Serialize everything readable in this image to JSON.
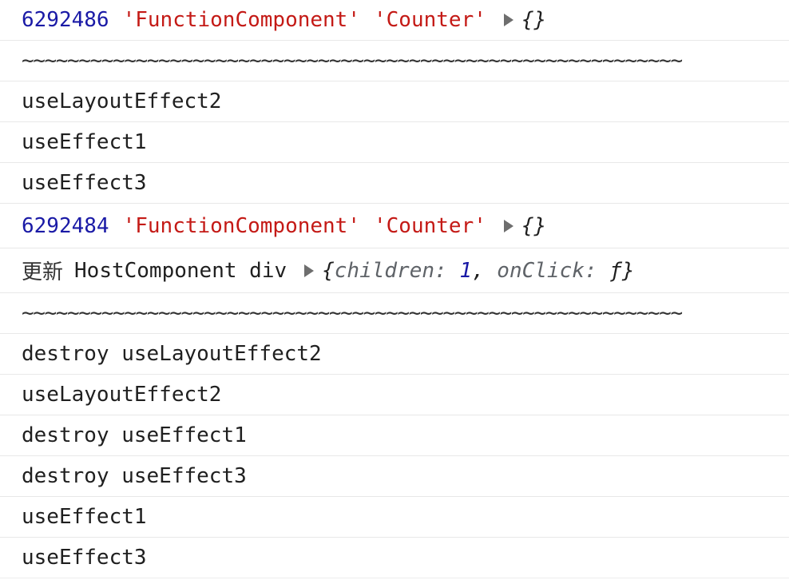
{
  "rows": [
    {
      "type": "component-log",
      "id": "6292486",
      "tag": "'FunctionComponent'",
      "name": "'Counter'",
      "object": "{}"
    },
    {
      "type": "separator",
      "text": "~~~~~~~~~~~~~~~~~~~~~~~~~~~~~~~~~~~~~~~~~~~~~~~~~~~~~~~~~~"
    },
    {
      "type": "text",
      "text": "useLayoutEffect2"
    },
    {
      "type": "text",
      "text": "useEffect1"
    },
    {
      "type": "text",
      "text": "useEffect3"
    },
    {
      "type": "component-log",
      "id": "6292484",
      "tag": "'FunctionComponent'",
      "name": "'Counter'",
      "object": "{}"
    },
    {
      "type": "update-log",
      "prefix": "更新",
      "text": "HostComponent div",
      "object_open": "{",
      "key1": "children",
      "colon": ": ",
      "value1": "1",
      "comma": ", ",
      "key2": "onClick",
      "value2": "ƒ",
      "object_close": "}"
    },
    {
      "type": "separator",
      "text": "~~~~~~~~~~~~~~~~~~~~~~~~~~~~~~~~~~~~~~~~~~~~~~~~~~~~~~~~~~"
    },
    {
      "type": "text",
      "text": "destroy useLayoutEffect2"
    },
    {
      "type": "text",
      "text": "useLayoutEffect2"
    },
    {
      "type": "text",
      "text": "destroy useEffect1"
    },
    {
      "type": "text",
      "text": "destroy useEffect3"
    },
    {
      "type": "text",
      "text": "useEffect1"
    },
    {
      "type": "text",
      "text": "useEffect3"
    }
  ],
  "colors": {
    "number": "#1a1aa6",
    "string": "#c41a16",
    "text": "#1f1f1f",
    "property_key": "#5f6368",
    "row_border": "#e8e8e8"
  },
  "icons": {
    "expand": "triangle-right-icon"
  }
}
